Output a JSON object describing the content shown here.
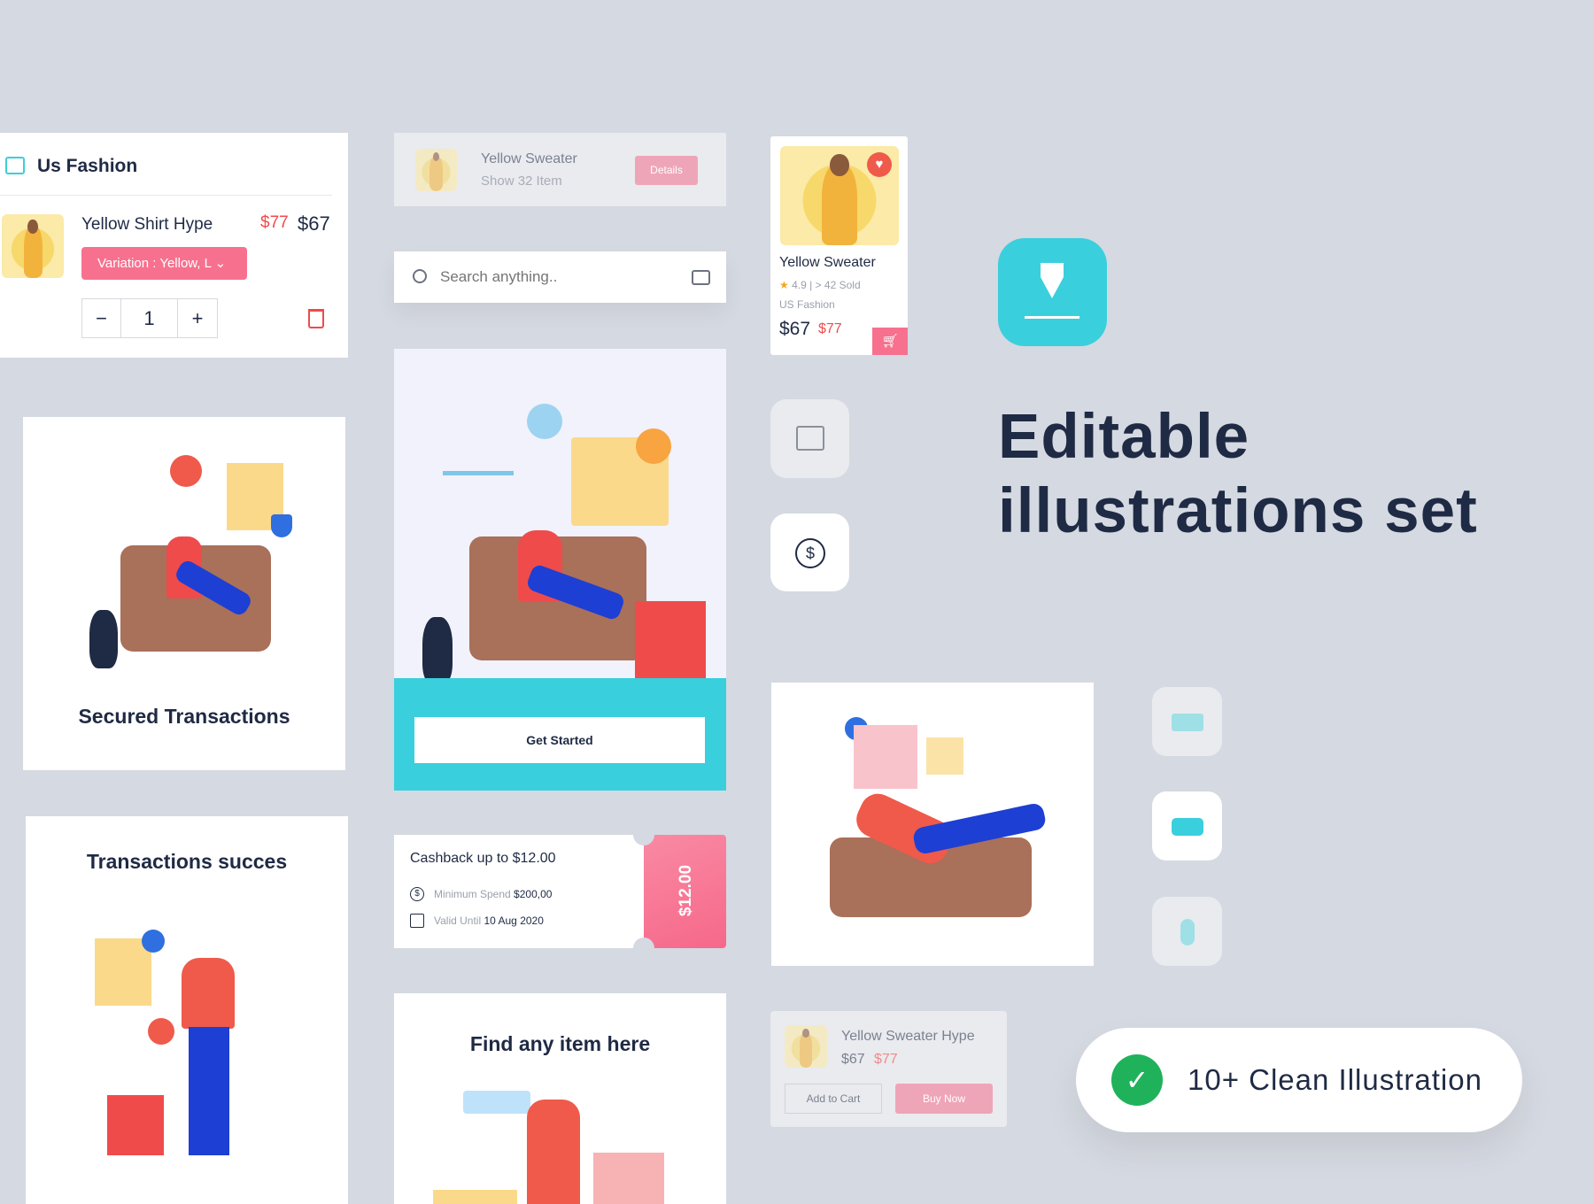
{
  "cart": {
    "store": "Us Fashion",
    "product": "Yellow Shirt Hype",
    "old_price": "$77",
    "price": "$67",
    "variation": "Variation : Yellow, L",
    "quantity": "1"
  },
  "details_card": {
    "title": "Yellow Sweater",
    "subtitle": "Show 32 Item",
    "button": "Details"
  },
  "search": {
    "placeholder": "Search anything.."
  },
  "onboarding": {
    "button": "Get Started"
  },
  "secured": {
    "title": "Secured Transactions"
  },
  "success": {
    "title": "Transactions succes"
  },
  "cashback": {
    "title": "Cashback up to $12.00",
    "min_label": "Minimum Spend",
    "min_value": "$200,00",
    "valid_label": "Valid Until",
    "valid_value": "10 Aug 2020",
    "amount": "$12.00"
  },
  "find": {
    "title": "Find any item here"
  },
  "product": {
    "name": "Yellow Sweater",
    "rating": "4.9",
    "sold": "> 42 Sold",
    "store": "US Fashion",
    "price": "$67",
    "old_price": "$77"
  },
  "headline": {
    "line1": "Editable",
    "line2": "illustrations set"
  },
  "buy_card": {
    "name": "Yellow Sweater Hype",
    "price": "$67",
    "old_price": "$77",
    "add": "Add to Cart",
    "buy": "Buy Now"
  },
  "badge": {
    "text": "10+ Clean Illustration"
  },
  "colors": {
    "accent": "#3acfdc",
    "pink": "#f7718f",
    "red": "#ef4b4b",
    "navy": "#1f2a44",
    "background": "#d5d9e1"
  }
}
